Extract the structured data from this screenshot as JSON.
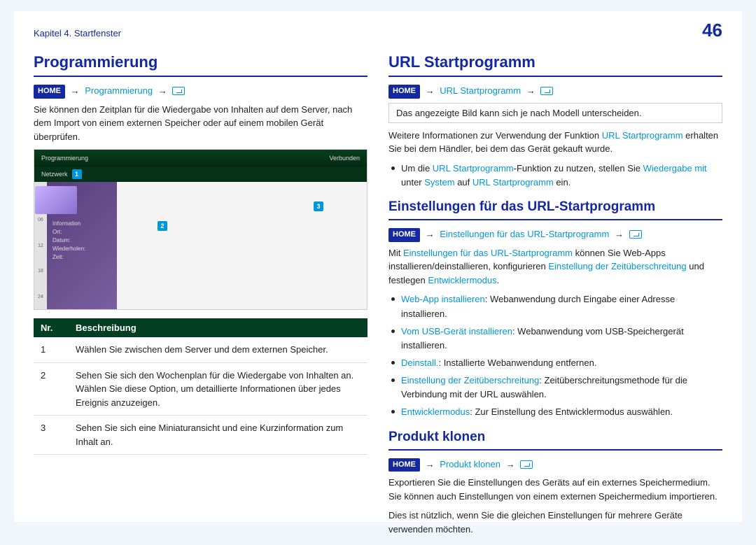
{
  "header": {
    "chapter": "Kapitel 4. Startfenster",
    "page_number": "46"
  },
  "nav": {
    "home_label": "HOME",
    "arrow": "→"
  },
  "left": {
    "h1": "Programmierung",
    "crumb_link": "Programmierung",
    "intro": "Sie können den Zeitplan für die Wiedergabe von Inhalten auf dem Server, nach dem Import von einem externen Speicher oder auf einem mobilen Gerät überprüfen.",
    "screenshot": {
      "title": "Programmierung",
      "status": "Verbunden",
      "network": "Netzwerk",
      "marker1": "1",
      "marker2": "2",
      "marker3": "3",
      "info_title": "Information",
      "info_lines": [
        "Ort:",
        "Datum:",
        "Wiederholen:",
        "Zeit:"
      ]
    },
    "table": {
      "col1": "Nr.",
      "col2": "Beschreibung",
      "rows": [
        {
          "n": "1",
          "d": "Wählen Sie zwischen dem Server und dem externen Speicher."
        },
        {
          "n": "2",
          "d": "Sehen Sie sich den Wochenplan für die Wiedergabe von Inhalten an.\nWählen Sie diese Option, um detaillierte Informationen über jedes Ereignis anzuzeigen."
        },
        {
          "n": "3",
          "d": "Sehen Sie sich eine Miniaturansicht und eine Kurzinformation zum Inhalt an."
        }
      ]
    }
  },
  "right": {
    "s1": {
      "h": "URL Startprogramm",
      "crumb_link": "URL Startprogramm",
      "note": "Das angezeigte Bild kann sich je nach Modell unterscheiden.",
      "p1a": "Weitere Informationen zur Verwendung der Funktion ",
      "p1_link": "URL Startprogramm",
      "p1b": " erhalten Sie bei dem Händler, bei dem das Gerät gekauft wurde.",
      "li1a": "Um die ",
      "li1_l1": "URL Startprogramm",
      "li1b": "-Funktion zu nutzen, stellen Sie ",
      "li1_l2": "Wiedergabe mit",
      "li1c": " unter ",
      "li1_l3": "System",
      "li1d": " auf ",
      "li1_l4": "URL Startprogramm",
      "li1e": " ein."
    },
    "s2": {
      "h": "Einstellungen für das URL-Startprogramm",
      "crumb_link": "Einstellungen für das URL-Startprogramm",
      "p1a": "Mit ",
      "p1_l1": "Einstellungen für das URL-Startprogramm",
      "p1b": " können Sie Web-Apps installieren/deinstallieren, konfigurieren ",
      "p1_l2": "Einstellung der Zeitüberschreitung",
      "p1c": " und festlegen ",
      "p1_l3": "Entwicklermodus",
      "p1d": ".",
      "items": [
        {
          "term": "Web-App installieren",
          "desc": ": Webanwendung durch Eingabe einer Adresse installieren."
        },
        {
          "term": "Vom USB-Gerät installieren",
          "desc": ": Webanwendung vom USB-Speichergerät installieren."
        },
        {
          "term": "Deinstall.",
          "desc": ": Installierte Webanwendung entfernen."
        },
        {
          "term": "Einstellung der Zeitüberschreitung",
          "desc": ": Zeitüberschreitungsmethode für die Verbindung mit der URL auswählen."
        },
        {
          "term": "Entwicklermodus",
          "desc": ": Zur Einstellung des Entwicklermodus auswählen."
        }
      ]
    },
    "s3": {
      "h": "Produkt klonen",
      "crumb_link": "Produkt klonen",
      "p1": "Exportieren Sie die Einstellungen des Geräts auf ein externes Speichermedium. Sie können auch Einstellungen von einem externen Speichermedium importieren.",
      "p2": "Dies ist nützlich, wenn Sie die gleichen Einstellungen für mehrere Geräte verwenden möchten."
    }
  }
}
